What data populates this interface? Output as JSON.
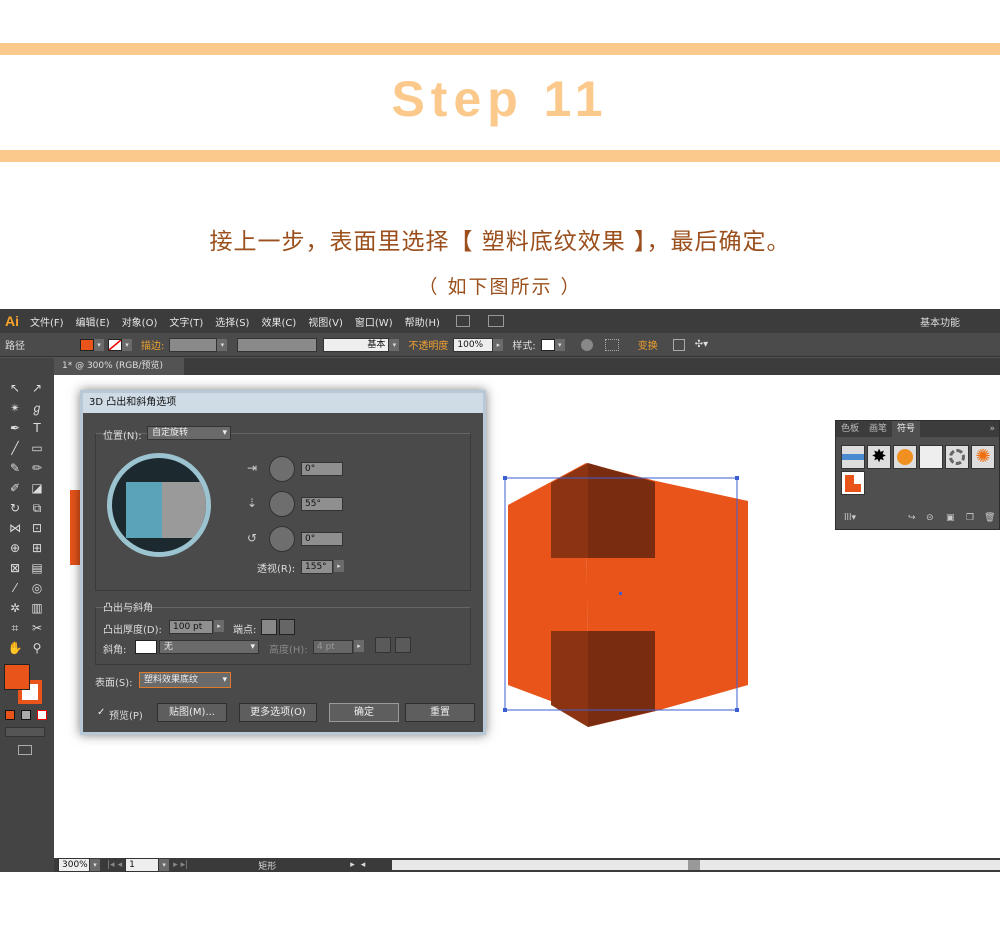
{
  "header": {
    "step_title": "Step 11",
    "instruction": "接上一步，表面里选择【 塑料底纹效果 】，最后确定。",
    "subtitle": "（ 如下图所示 ）",
    "band_color": "#fbc98c",
    "text_color": "#9a4f1c"
  },
  "app": {
    "logo": "Ai",
    "menu": [
      "文件(F)",
      "编辑(E)",
      "对象(O)",
      "文字(T)",
      "选择(S)",
      "效果(C)",
      "视图(V)",
      "窗口(W)",
      "帮助(H)"
    ],
    "workspace": "基本功能",
    "control_bar": {
      "object_type": "路径",
      "stroke_label": "描边:",
      "brush_label": "基本",
      "opacity_label": "不透明度",
      "opacity_value": "100%",
      "style_label": "样式:",
      "transform_label": "变换",
      "fill_color": "#e8541a"
    },
    "doc_tab": "1* @ 300% (RGB/预览)",
    "status": {
      "zoom": "300%",
      "page": "1",
      "tool_name": "矩形"
    }
  },
  "dialog": {
    "title": "3D 凸出和斜角选项",
    "position_label": "位置(N):",
    "position_value": "自定旋转",
    "rot_x": "0°",
    "rot_y": "55°",
    "rot_z": "0°",
    "perspective_label": "透视(R):",
    "perspective_value": "155°",
    "extrude_group": "凸出与斜角",
    "depth_label": "凸出厚度(D):",
    "depth_value": "100 pt",
    "cap_label": "端点:",
    "bevel_label": "斜角:",
    "bevel_value": "无",
    "height_label": "高度(H):",
    "height_value": "4 pt",
    "surface_label": "表面(S):",
    "surface_value": "塑料效果底纹",
    "preview_label": "预览(P)",
    "map_button": "贴图(M)...",
    "more_button": "更多选项(O)",
    "ok_button": "确定",
    "reset_button": "重置"
  },
  "symbols_panel": {
    "tabs": [
      "色板",
      "画笔",
      "符号"
    ],
    "active_tab": "符号"
  },
  "artwork": {
    "front_color": "#e8541a",
    "side_color": "#8c3312"
  }
}
